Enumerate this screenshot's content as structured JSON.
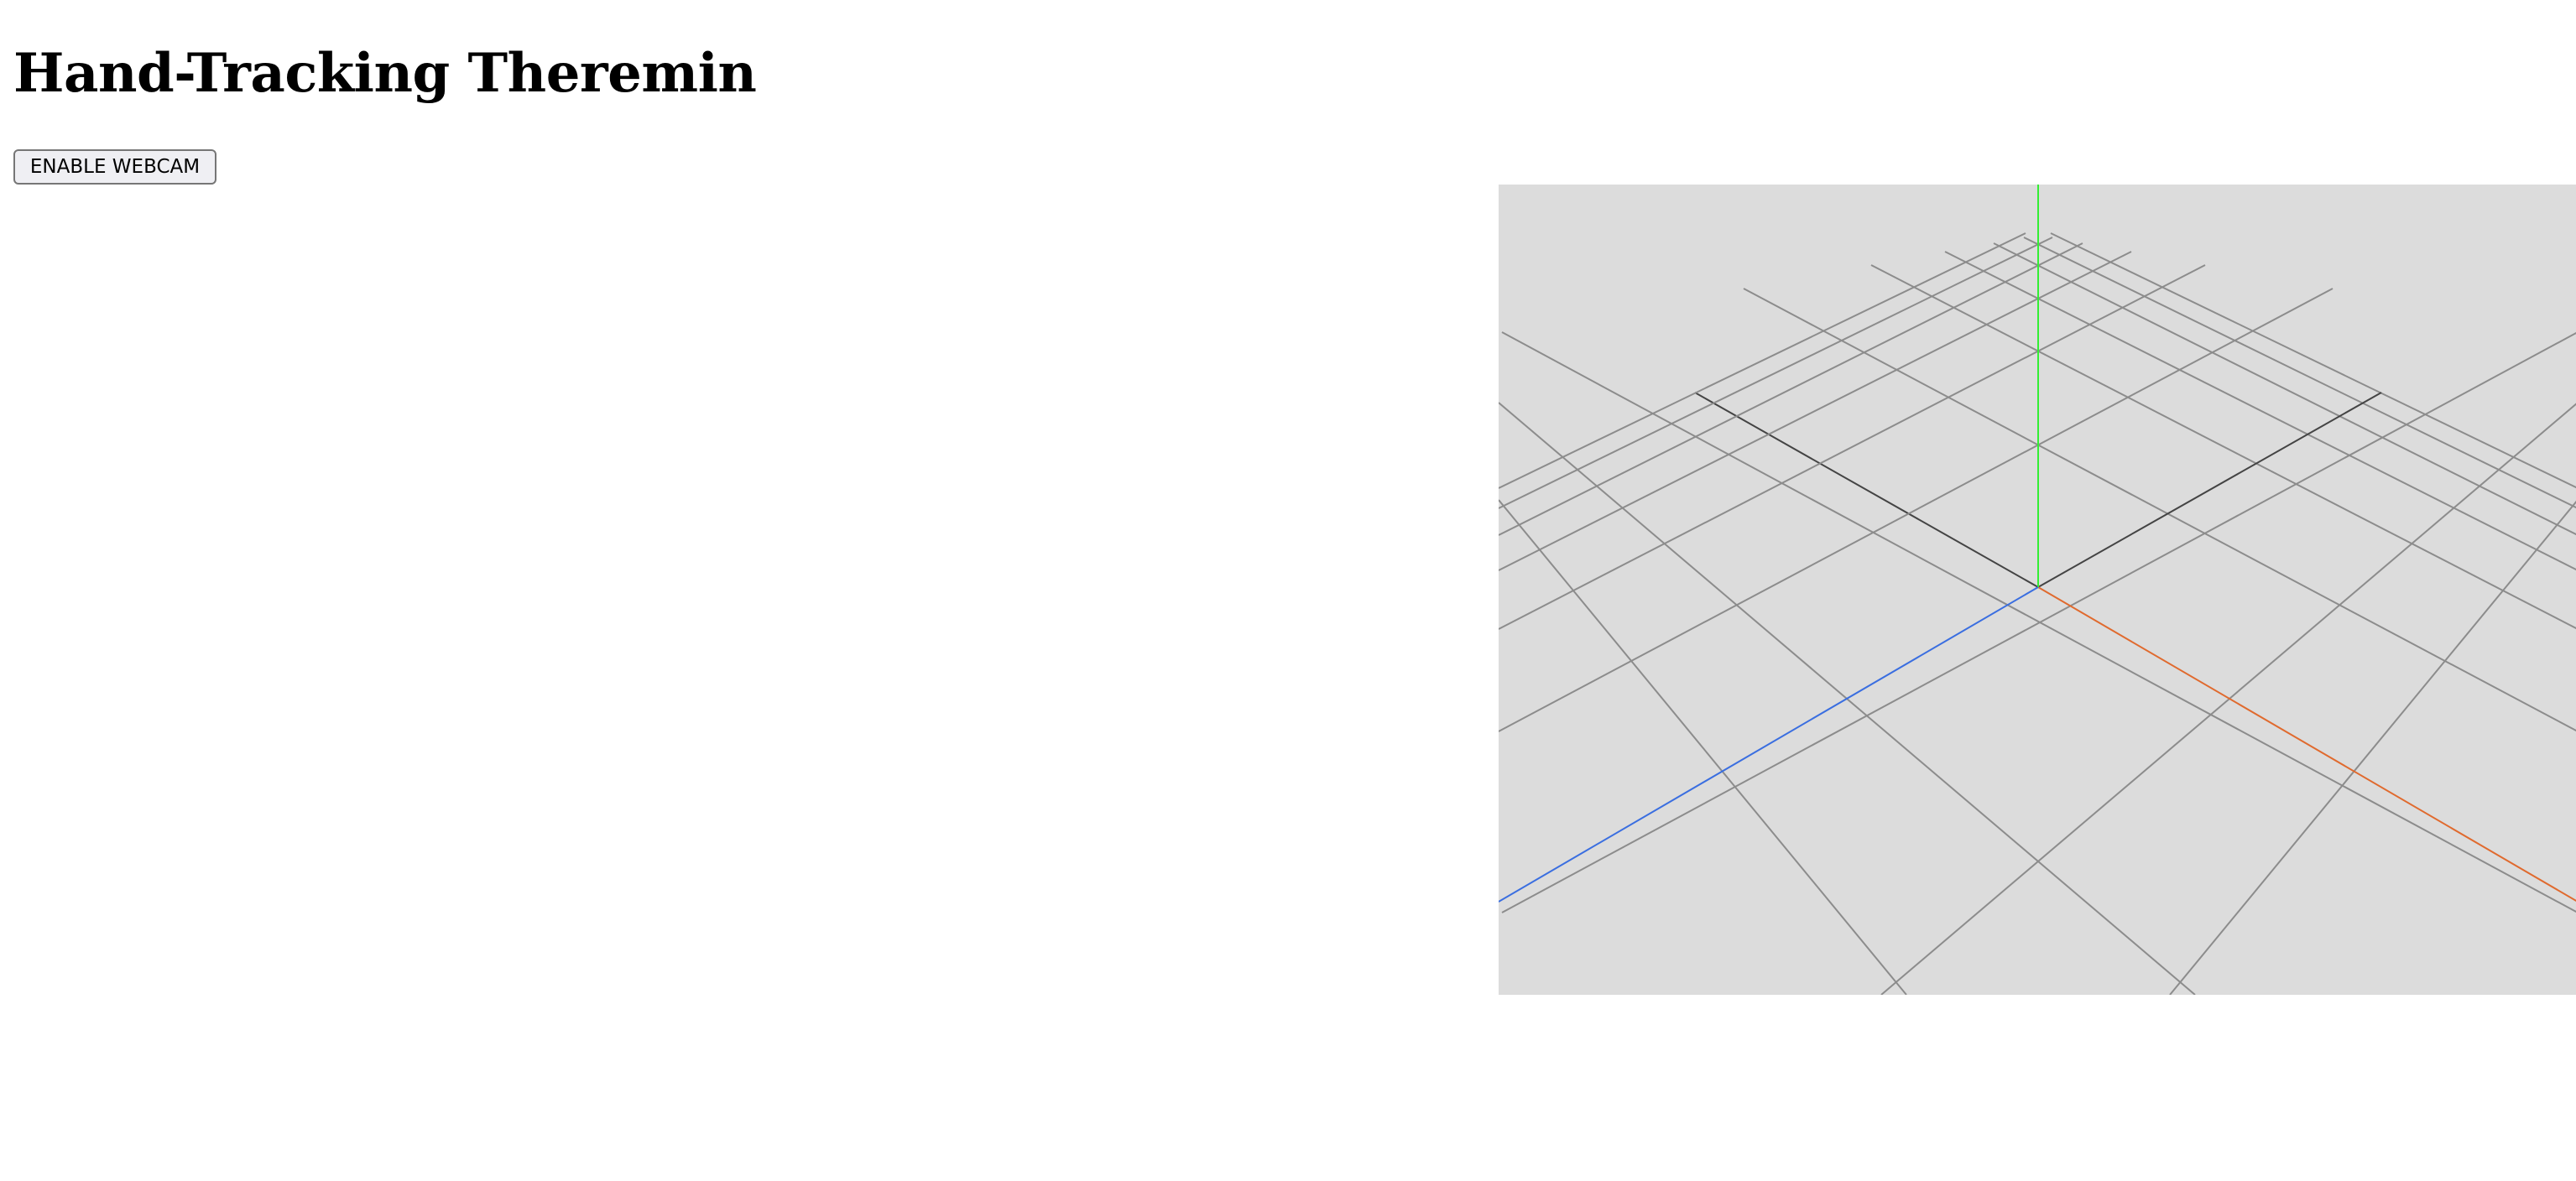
{
  "page": {
    "title": "Hand-Tracking Theremin"
  },
  "controls": {
    "webcam_button_label": "ENABLE WEBCAM"
  },
  "scene": {
    "background_color": "#dcdcdc",
    "grid_color": "#8c8c8c",
    "grid_center_color": "#444444",
    "axis_colors": {
      "x": "#e06a2e",
      "y": "#33ee33",
      "z": "#3a6ee0"
    }
  }
}
